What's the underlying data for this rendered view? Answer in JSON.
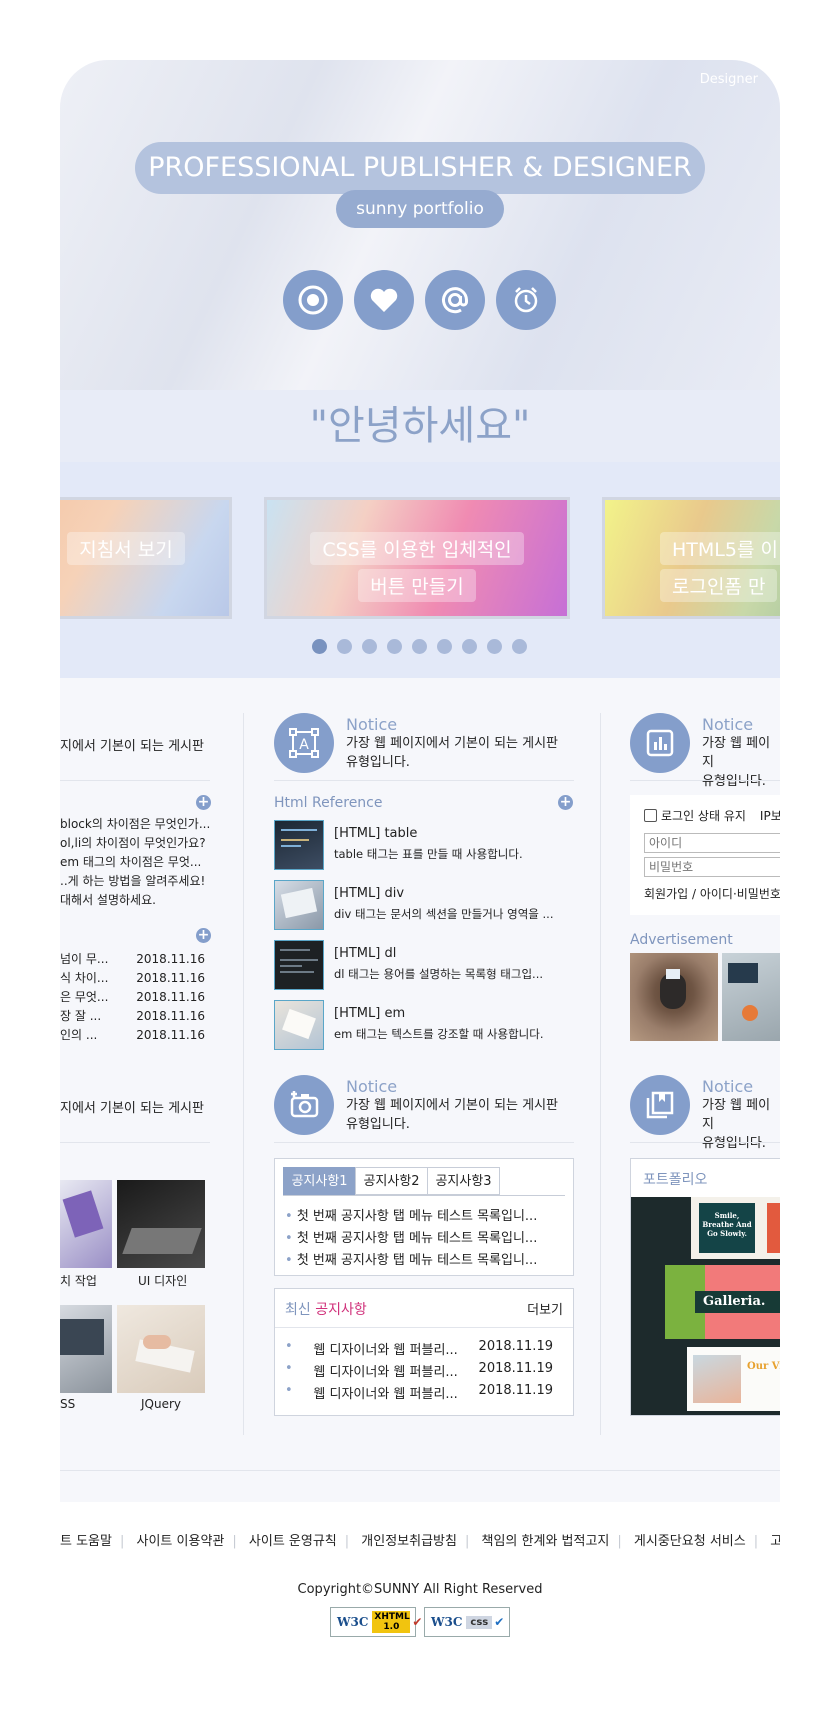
{
  "hero": {
    "corner_label": "Designer",
    "title": "PROFESSIONAL PUBLISHER & DESIGNER",
    "subtitle": "sunny portfolio",
    "icons": [
      "target-icon",
      "heart-icon",
      "at-icon",
      "alarm-icon"
    ]
  },
  "greeting": "\"안녕하세요\"",
  "slider": {
    "slides": [
      {
        "line1": "지침서 보기",
        "line2": ""
      },
      {
        "line1": "CSS를 이용한 입체적인",
        "line2": "버튼 만들기"
      },
      {
        "line1": "HTML5를 이",
        "line2": "로그인폼 만"
      }
    ],
    "dot_count": 9,
    "active_dot": 0
  },
  "row1": {
    "left": {
      "desc": "지에서 기본이 되는 게시판",
      "list1": [
        "block의 차이점은 무엇인가...",
        "ol,li의 차이점이 무엇인가요?",
        "em 태그의 차이점은 무엇...",
        "..게 하는 방법을 알려주세요!",
        "대해서 설명하세요."
      ],
      "list2": [
        {
          "t": "넘이 무...",
          "date": "2018.11.16"
        },
        {
          "t": "식 차이...",
          "date": "2018.11.16"
        },
        {
          "t": "은 무엇...",
          "date": "2018.11.16"
        },
        {
          "t": "장 잘 ...",
          "date": "2018.11.16"
        },
        {
          "t": "인의 ...",
          "date": "2018.11.16"
        }
      ]
    },
    "middle": {
      "notice_title": "Notice",
      "notice_desc1": "가장 웹 페이지에서 기본이 되는 게시판",
      "notice_desc2": "유형입니다.",
      "section_title": "Html Reference",
      "items": [
        {
          "title": "[HTML] table",
          "desc": "table 태그는 표를 만들 때 사용합니다."
        },
        {
          "title": "[HTML] div",
          "desc": "div 태그는 문서의 섹션을 만들거나 영역을 ..."
        },
        {
          "title": "[HTML] dl",
          "desc": "dl 태그는 용어를 설명하는 목록형 태그입..."
        },
        {
          "title": "[HTML] em",
          "desc": "em 태그는 텍스트를 강조할 때 사용합니다."
        }
      ]
    },
    "right": {
      "notice_title": "Notice",
      "notice_desc1": "가장 웹 페이지",
      "notice_desc2": "유형입니다.",
      "keep_login": "로그인 상태 유지",
      "ip": "IP보",
      "id_placeholder": "아이디",
      "pw_placeholder": "비밀번호",
      "links": "회원가입 / 아이디·비밀번호",
      "ad_title": "Advertisement"
    }
  },
  "row2": {
    "left": {
      "desc": "지에서 기본이 되는 게시판",
      "captions": [
        "치 작업",
        "UI 디자인",
        "SS",
        "JQuery"
      ]
    },
    "middle": {
      "notice_title": "Notice",
      "notice_desc1": "가장 웹 페이지에서 기본이 되는 게시판",
      "notice_desc2": "유형입니다.",
      "tabs": [
        "공지사항1",
        "공지사항2",
        "공지사항3"
      ],
      "tab_items": [
        "첫 번째 공지사항 탭 메뉴 테스트 목록입니...",
        "첫 번째 공지사항 탭 메뉴 테스트 목록입니...",
        "첫 번째 공지사항 탭 메뉴 테스트 목록입니..."
      ],
      "latest_prefix": "최신",
      "latest_highlight": "공지사항",
      "more": "더보기",
      "latest_items": [
        {
          "t": "웹 디자이너와 웹 퍼블리...",
          "date": "2018.11.19"
        },
        {
          "t": "웹 디자이너와 웹 퍼블리...",
          "date": "2018.11.19"
        },
        {
          "t": "웹 디자이너와 웹 퍼블리...",
          "date": "2018.11.19"
        }
      ]
    },
    "right": {
      "notice_title": "Notice",
      "notice_desc1": "가장 웹 페이지",
      "notice_desc2": "유형입니다.",
      "portfolio_title": "포트폴리오",
      "card1": "Smile, Breathe And Go Slowly.",
      "card2": "Galleria.",
      "card3": "Our Visi"
    }
  },
  "footer": {
    "links": [
      "트 도움말",
      "사이트 이용약관",
      "사이트 운영규칙",
      "개인정보취급방침",
      "책임의 한계와 법적고지",
      "게시중단요청 서비스",
      "고객"
    ],
    "copyright": "Copyright©SUNNY All Right Reserved",
    "badge1_a": "W3C",
    "badge1_b": "XHTML 1.0",
    "badge2_a": "W3C",
    "badge2_b": "css"
  },
  "colors": {
    "accent": "#849ecb",
    "accent_light": "#b4c3de",
    "text": "#222222",
    "highlight": "#d0307a"
  }
}
